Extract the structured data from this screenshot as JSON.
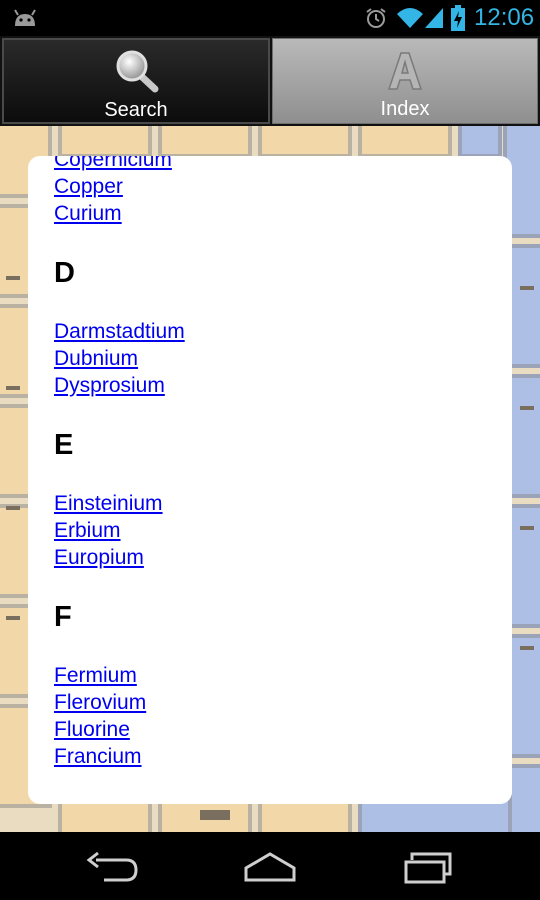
{
  "status_bar": {
    "time": "12:06",
    "accent_color": "#33b5e5",
    "icons": [
      "android-icon",
      "alarm-icon",
      "wifi-icon",
      "signal-icon",
      "battery-charging-icon"
    ]
  },
  "tabs": [
    {
      "label": "Search",
      "icon": "magnifier-icon",
      "selected": true
    },
    {
      "label": "Index",
      "icon": "letter-a-icon",
      "selected": false
    }
  ],
  "index": {
    "partial_top": [
      "Copernicium",
      "Copper",
      "Curium"
    ],
    "groups": [
      {
        "letter": "D",
        "items": [
          "Darmstadtium",
          "Dubnium",
          "Dysprosium"
        ]
      },
      {
        "letter": "E",
        "items": [
          "Einsteinium",
          "Erbium",
          "Europium"
        ]
      },
      {
        "letter": "F",
        "items": [
          "Fermium",
          "Flerovium",
          "Fluorine",
          "Francium"
        ]
      }
    ]
  },
  "nav_bar": {
    "buttons": [
      "back-button",
      "home-button",
      "recent-apps-button"
    ]
  },
  "colors": {
    "link": "#0000ee",
    "card": "#ffffff",
    "background_tiles": "#efd9b0",
    "background_blue": "#aebfe6"
  }
}
